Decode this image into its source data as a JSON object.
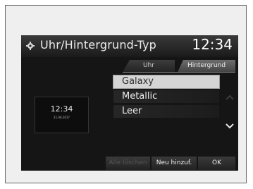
{
  "header": {
    "title": "Uhr/Hintergrund-Typ",
    "clock": "12:34",
    "icon": "gear-icon"
  },
  "tabs": [
    {
      "label": "Uhr",
      "active": false
    },
    {
      "label": "Hintergrund",
      "active": true
    }
  ],
  "list": {
    "items": [
      {
        "label": "Galaxy",
        "selected": true
      },
      {
        "label": "Metallic",
        "selected": false
      },
      {
        "label": "Leer",
        "selected": false
      }
    ]
  },
  "preview": {
    "time": "12:34",
    "date": "21.06.2017"
  },
  "buttons": {
    "disabled_label": "Alle löschen",
    "add_label": "Neu hinzuf.",
    "ok_label": "OK"
  }
}
